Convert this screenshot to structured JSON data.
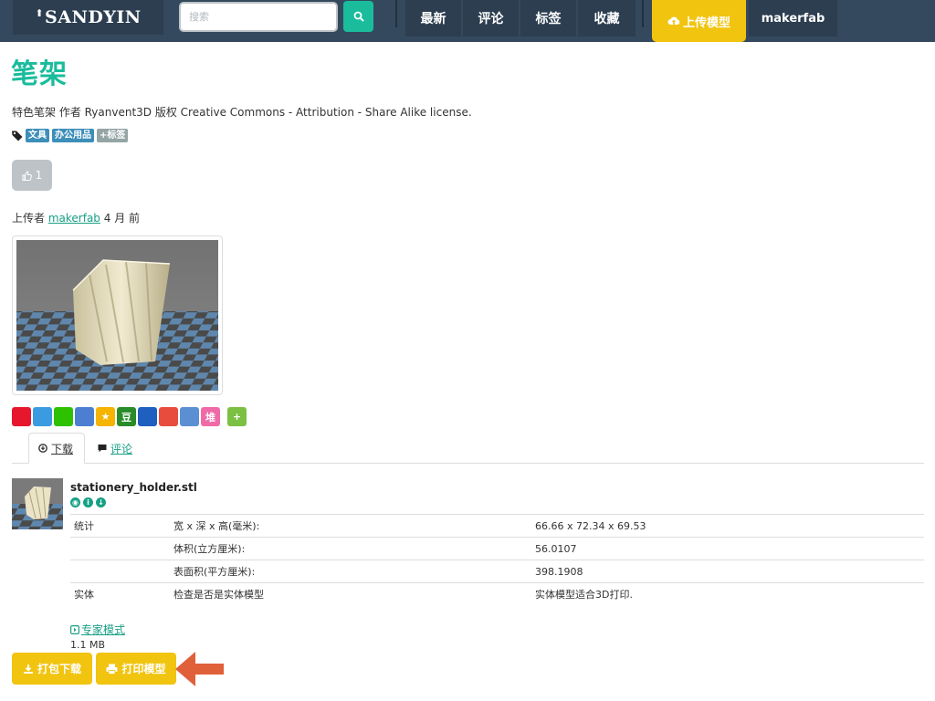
{
  "nav": {
    "logo": "SANDYIN",
    "search_placeholder": "搜索",
    "items": [
      "最新",
      "评论",
      "标签",
      "收藏"
    ],
    "upload": "上传模型",
    "user": "makerfab"
  },
  "model": {
    "title": "笔架",
    "description": "特色笔架 作者 Ryanvent3D 版权 Creative Commons - Attribution - Share Alike license.",
    "tags": [
      "文具",
      "办公用品",
      "+标签"
    ],
    "likes": "1",
    "uploader_prefix": "上传者",
    "uploader": "makerfab",
    "uploaded_ago": "4 月 前"
  },
  "share": {
    "icons": [
      "weibo-icon",
      "tencent-weibo-icon",
      "wechat-icon",
      "qq-icon",
      "qzone-icon",
      "douban-icon",
      "renren-icon",
      "kaixin-icon",
      "renren-share-icon",
      "duitang-icon",
      "more-icon"
    ],
    "labels": [
      "",
      "",
      "",
      "",
      "★",
      "豆",
      "",
      "",
      "",
      "堆",
      "+"
    ]
  },
  "tabs": [
    "下载",
    "评论"
  ],
  "file": {
    "name": "stationery_holder.stl",
    "stats": [
      {
        "group": "统计",
        "label": "宽 x 深 x 高(毫米):",
        "value": "66.66 x 72.34 x 69.53"
      },
      {
        "group": "",
        "label": "体积(立方厘米):",
        "value": "56.0107"
      },
      {
        "group": "",
        "label": "表面积(平方厘米):",
        "value": "398.1908"
      },
      {
        "group": "实体",
        "label": "检查是否是实体模型",
        "value": "实体模型适合3D打印."
      }
    ],
    "expert_mode": "专家模式",
    "size": "1.1 MB"
  },
  "actions": {
    "download": "打包下载",
    "print": "打印模型"
  },
  "colors": {
    "navbar": "#34495e",
    "accent": "#1abc9c",
    "button_yellow": "#f1c40f",
    "arrow": "#e0603a"
  }
}
